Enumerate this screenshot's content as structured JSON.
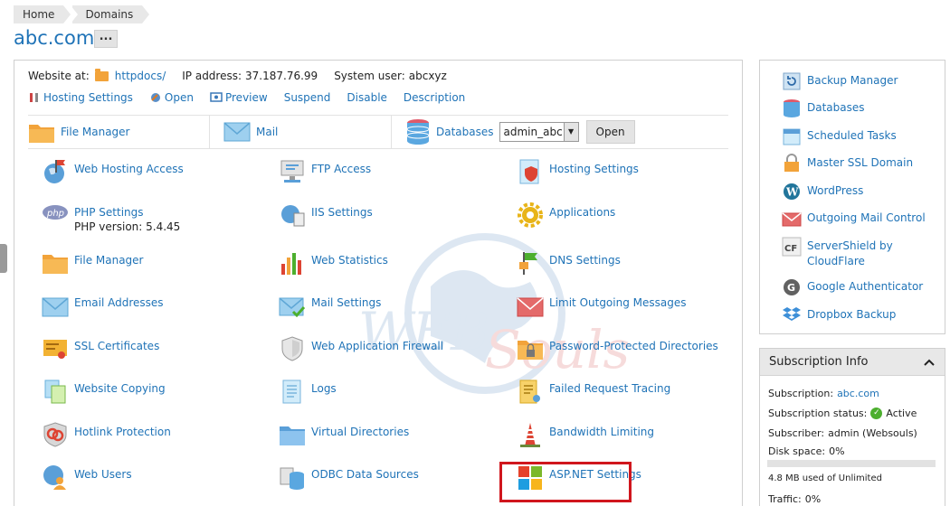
{
  "breadcrumb": [
    "Home",
    "Domains"
  ],
  "page_title": "abc.com",
  "more_label": "...",
  "info": {
    "website_label": "Website at:",
    "website_folder": "httpdocs/",
    "ip_label": "IP address:",
    "ip_value": "37.187.76.99",
    "user_label": "System user:",
    "user_value": "abcxyz"
  },
  "actions": [
    "Hosting Settings",
    "Open",
    "Preview",
    "Suspend",
    "Disable",
    "Description"
  ],
  "quick": {
    "file_manager": "File Manager",
    "mail": "Mail",
    "databases": "Databases",
    "db_selected": "admin_abc",
    "open": "Open"
  },
  "tools": [
    {
      "label": "Web Hosting Access",
      "icon": "globe-flag-icon"
    },
    {
      "label": "FTP Access",
      "icon": "ftp-monitor-icon"
    },
    {
      "label": "Hosting Settings",
      "icon": "hosting-shield-icon"
    },
    {
      "label": "PHP Settings",
      "sub": "PHP version: 5.4.45",
      "icon": "php-icon"
    },
    {
      "label": "IIS Settings",
      "icon": "iis-globe-icon"
    },
    {
      "label": "Applications",
      "icon": "gear-icon"
    },
    {
      "label": "File Manager",
      "icon": "folder-icon"
    },
    {
      "label": "Web Statistics",
      "icon": "bar-chart-icon"
    },
    {
      "label": "DNS Settings",
      "icon": "dns-flag-icon"
    },
    {
      "label": "Email Addresses",
      "icon": "envelope-icon"
    },
    {
      "label": "Mail Settings",
      "icon": "mail-check-icon"
    },
    {
      "label": "Limit Outgoing Messages",
      "icon": "mail-limit-icon"
    },
    {
      "label": "SSL Certificates",
      "icon": "certificate-icon"
    },
    {
      "label": "Web Application Firewall",
      "icon": "firewall-shield-icon"
    },
    {
      "label": "Password-Protected Directories",
      "icon": "locked-folder-icon"
    },
    {
      "label": "Website Copying",
      "icon": "copy-docs-icon"
    },
    {
      "label": "Logs",
      "icon": "logs-icon"
    },
    {
      "label": "Failed Request Tracing",
      "icon": "trace-doc-icon"
    },
    {
      "label": "Hotlink Protection",
      "icon": "hotlink-shield-icon"
    },
    {
      "label": "Virtual Directories",
      "icon": "virtual-folder-icon"
    },
    {
      "label": "Bandwidth Limiting",
      "icon": "bandwidth-tower-icon"
    },
    {
      "label": "Web Users",
      "icon": "web-users-icon"
    },
    {
      "label": "ODBC Data Sources",
      "icon": "odbc-database-icon"
    },
    {
      "label": "ASP.NET Settings",
      "icon": "aspnet-windows-icon"
    }
  ],
  "sidebar": [
    {
      "label": "Backup Manager",
      "icon": "backup-icon"
    },
    {
      "label": "Databases",
      "icon": "database-icon"
    },
    {
      "label": "Scheduled Tasks",
      "icon": "calendar-icon"
    },
    {
      "label": "Master SSL Domain",
      "icon": "ssl-lock-icon"
    },
    {
      "label": "WordPress",
      "icon": "wordpress-icon"
    },
    {
      "label": "Outgoing Mail Control",
      "icon": "outgoing-mail-icon"
    },
    {
      "label": "ServerShield by CloudFlare",
      "icon": "cloudflare-icon"
    },
    {
      "label": "Google Authenticator",
      "icon": "google-auth-icon"
    },
    {
      "label": "Dropbox Backup",
      "icon": "dropbox-icon"
    }
  ],
  "subscription": {
    "title": "Subscription Info",
    "subscription_label": "Subscription:",
    "subscription_value": "abc.com",
    "status_label": "Subscription status:",
    "status_value": "Active",
    "subscriber_label": "Subscriber:",
    "subscriber_value": "admin (Websouls)",
    "disk_label": "Disk space:",
    "disk_value": "0%",
    "disk_used": "4.8 MB used of Unlimited",
    "traffic_label": "Traffic:",
    "traffic_value": "0%"
  },
  "colors": {
    "link": "#1f73b7",
    "highlight": "#d0161d",
    "ok": "#4caf2e"
  }
}
